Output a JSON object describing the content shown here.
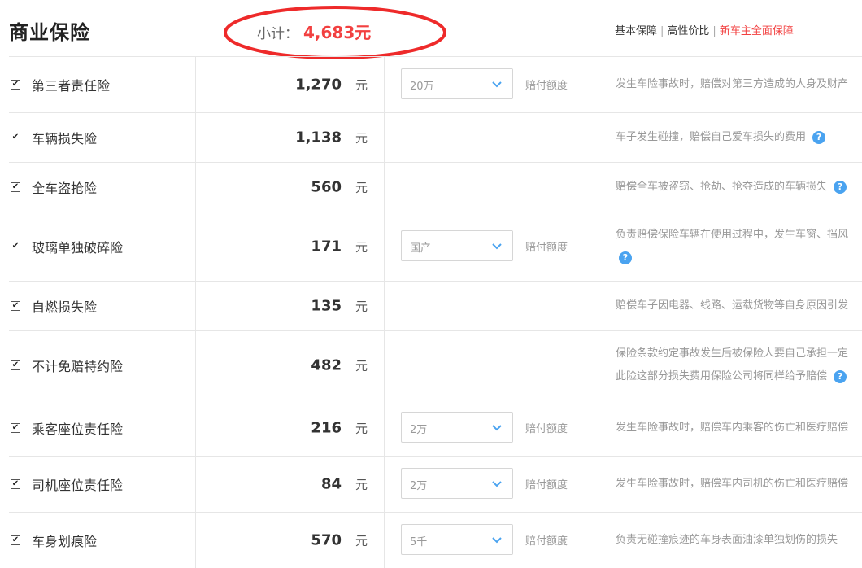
{
  "header": {
    "title": "商业保险",
    "subtotal_label": "小计：",
    "subtotal_value": "4,683元",
    "plans": [
      {
        "label": "基本保障",
        "active": false
      },
      {
        "label": "高性价比",
        "active": false
      },
      {
        "label": "新车主全面保障",
        "active": true
      }
    ]
  },
  "colors": {
    "accent_red": "#f24040",
    "help_blue": "#4aa3f0",
    "muted": "#999999"
  },
  "unit": "元",
  "option_label": "赔付额度",
  "rows": [
    {
      "name": "第三者责任险",
      "checked": true,
      "price": "1,270",
      "option": "20万",
      "desc": [
        "发生车险事故时，赔偿对第三方造成的人身及财产"
      ],
      "help": false
    },
    {
      "name": "车辆损失险",
      "checked": true,
      "price": "1,138",
      "option": null,
      "desc": [
        "车子发生碰撞，赔偿自己爱车损失的费用"
      ],
      "help": true
    },
    {
      "name": "全车盗抢险",
      "checked": true,
      "price": "560",
      "option": null,
      "desc": [
        "赔偿全车被盗窃、抢劫、抢夺造成的车辆损失"
      ],
      "help": true
    },
    {
      "name": "玻璃单独破碎险",
      "checked": true,
      "price": "171",
      "option": "国产",
      "desc": [
        "负责赔偿保险车辆在使用过程中，发生车窗、挡风"
      ],
      "help": true,
      "help_line2": true
    },
    {
      "name": "自燃损失险",
      "checked": true,
      "price": "135",
      "option": null,
      "desc": [
        "赔偿车子因电器、线路、运载货物等自身原因引发"
      ],
      "help": false
    },
    {
      "name": "不计免赔特约险",
      "checked": true,
      "price": "482",
      "option": null,
      "desc": [
        "保险条款约定事故发生后被保险人要自己承担一定",
        "此险这部分损失费用保险公司将同样给予赔偿"
      ],
      "help": true
    },
    {
      "name": "乘客座位责任险",
      "checked": true,
      "price": "216",
      "option": "2万",
      "desc": [
        "发生车险事故时，赔偿车内乘客的伤亡和医疗赔偿"
      ],
      "help": false
    },
    {
      "name": "司机座位责任险",
      "checked": true,
      "price": "84",
      "option": "2万",
      "desc": [
        "发生车险事故时，赔偿车内司机的伤亡和医疗赔偿"
      ],
      "help": false
    },
    {
      "name": "车身划痕险",
      "checked": true,
      "price": "570",
      "option": "5千",
      "desc": [
        "负责无碰撞痕迹的车身表面油漆单独划伤的损失"
      ],
      "help": false
    }
  ]
}
